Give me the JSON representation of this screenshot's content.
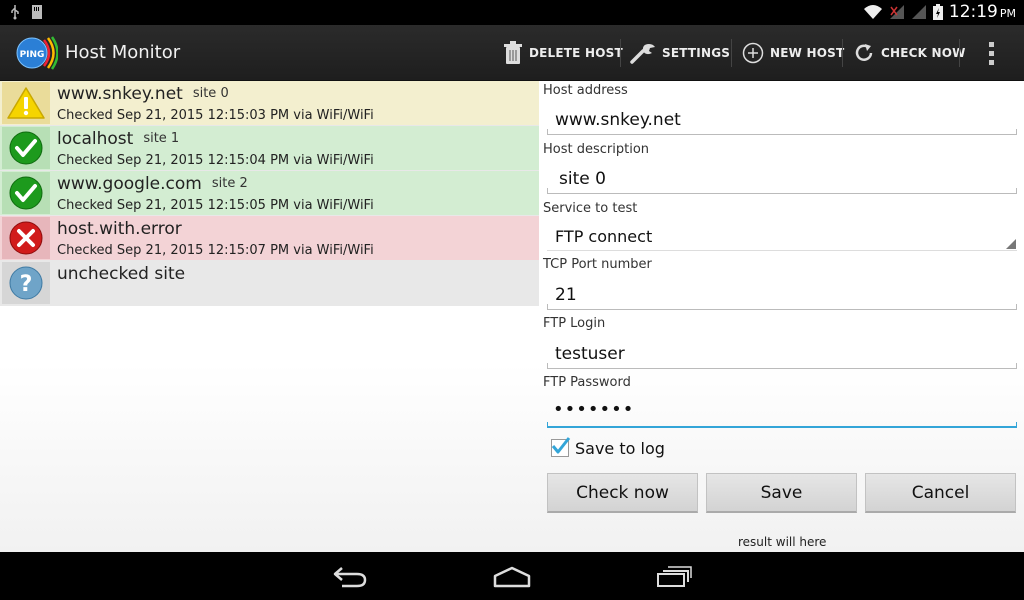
{
  "status_bar": {
    "time": "12:19",
    "ampm": "PM"
  },
  "action_bar": {
    "app_title": "Host Monitor",
    "logo_text": "PING",
    "actions": [
      {
        "label": "DELETE HOST",
        "icon": "trash-icon"
      },
      {
        "label": "SETTINGS",
        "icon": "wrench-icon"
      },
      {
        "label": "NEW HOST",
        "icon": "plus-circle-icon"
      },
      {
        "label": "CHECK NOW",
        "icon": "refresh-icon"
      }
    ],
    "overflow_icon": "overflow-menu-icon"
  },
  "hosts": [
    {
      "name": "www.snkey.net",
      "desc": "site 0",
      "checked": "Checked Sep 21, 2015 12:15:03 PM via WiFi/WiFi",
      "status": "warning",
      "bg": "#f3efcf"
    },
    {
      "name": "localhost",
      "desc": "site 1",
      "checked": "Checked Sep 21, 2015 12:15:04 PM via WiFi/WiFi",
      "status": "ok",
      "bg": "#d3edd2"
    },
    {
      "name": "www.google.com",
      "desc": "site 2",
      "checked": "Checked Sep 21, 2015 12:15:05 PM via WiFi/WiFi",
      "status": "ok",
      "bg": "#d3edd2"
    },
    {
      "name": "host.with.error",
      "desc": "",
      "checked": "Checked Sep 21, 2015 12:15:07 PM via WiFi/WiFi",
      "status": "error",
      "bg": "#f3d3d6"
    },
    {
      "name": "unchecked site",
      "desc": "",
      "checked": "",
      "status": "unknown",
      "bg": "#e8e8e8"
    }
  ],
  "form": {
    "host_address_label": "Host address",
    "host_address_value": "www.snkey.net",
    "host_description_label": "Host description",
    "host_description_value": "site 0",
    "service_label": "Service to test",
    "service_value": "FTP connect",
    "port_label": "TCP Port number",
    "port_value": "21",
    "login_label": "FTP Login",
    "login_value": "testuser",
    "password_label": "FTP Password",
    "password_value": "•••••••",
    "save_to_log_label": "Save to log",
    "save_to_log_checked": true,
    "check_now_button": "Check now",
    "save_button": "Save",
    "cancel_button": "Cancel",
    "result_text": "result will here"
  },
  "colors": {
    "accent": "#33a5d8",
    "warning_bg": "#f3efcf",
    "ok_bg": "#d3edd2",
    "error_bg": "#f3d3d6",
    "unknown_bg": "#e8e8e8"
  }
}
